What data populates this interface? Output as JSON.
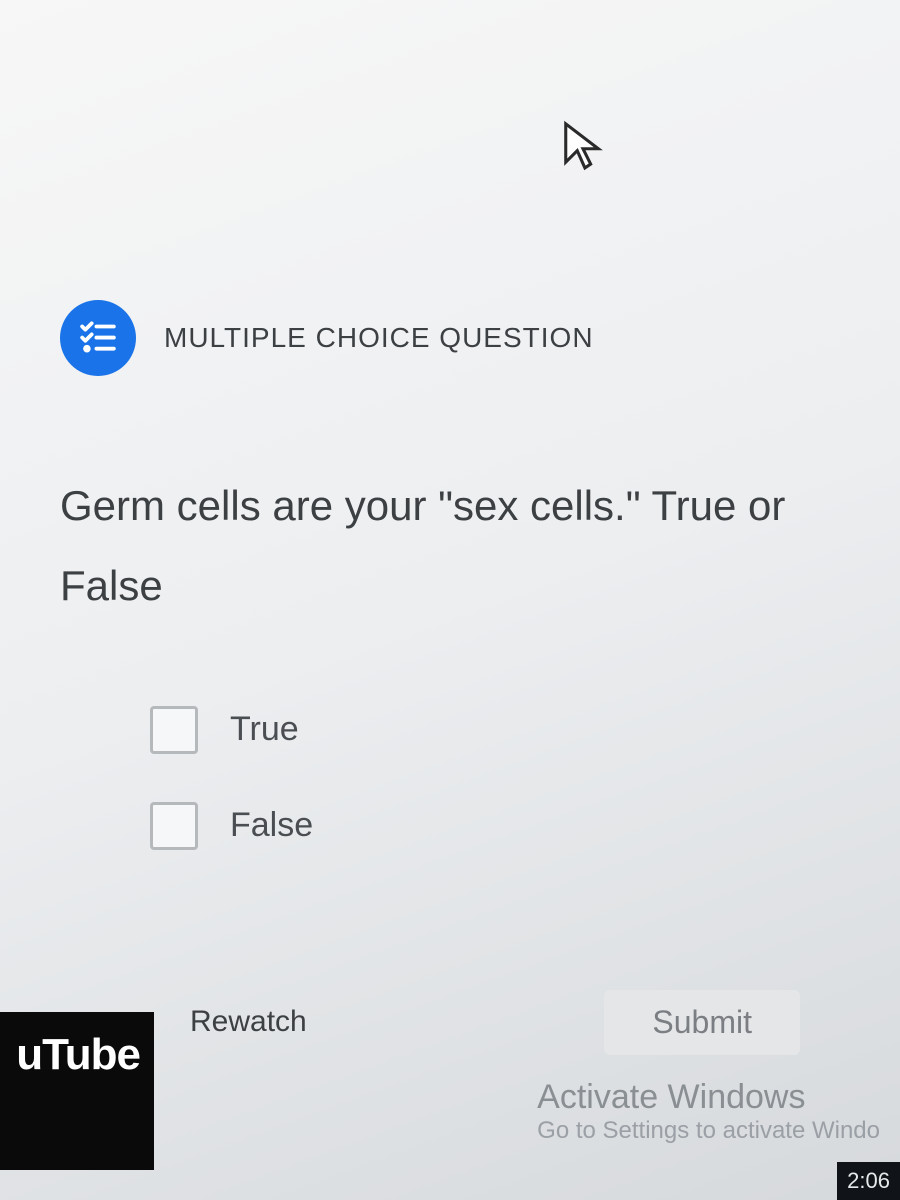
{
  "header": {
    "type_label": "MULTIPLE CHOICE QUESTION"
  },
  "question": {
    "text": "Germ cells are your \"sex cells.\" True or False"
  },
  "options": [
    {
      "label": "True"
    },
    {
      "label": "False"
    }
  ],
  "actions": {
    "rewatch": "Rewatch",
    "submit": "Submit"
  },
  "watermark": {
    "line1": "Activate Windows",
    "line2": "Go to Settings to activate Windo"
  },
  "fragments": {
    "youtube": "uTube",
    "clock": "2:06"
  }
}
